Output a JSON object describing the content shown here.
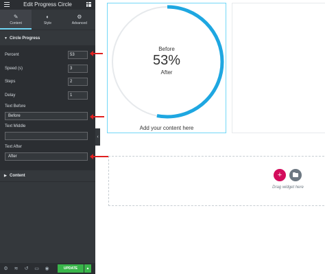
{
  "panel": {
    "title": "Edit Progress Circle",
    "tabs": [
      {
        "label": "Content",
        "icon": "pencil-icon",
        "active": true
      },
      {
        "label": "Style",
        "icon": "half-circle-icon",
        "active": false
      },
      {
        "label": "Advanced",
        "icon": "gear-icon",
        "active": false
      }
    ],
    "section_title": "Circle Progress",
    "fields": {
      "percent": {
        "label": "Percent",
        "value": "53"
      },
      "speed": {
        "label": "Speed (s)",
        "value": "3"
      },
      "steps": {
        "label": "Steps",
        "value": "2"
      },
      "delay": {
        "label": "Delay",
        "value": "1"
      },
      "text_before": {
        "label": "Text Before",
        "value": "Before"
      },
      "text_middle": {
        "label": "Text Middle",
        "value": ""
      },
      "text_after": {
        "label": "Text After",
        "value": "After"
      }
    },
    "content_section": "Content",
    "footer": {
      "update_label": "UPDATE",
      "icons": [
        "gear-icon",
        "layers-icon",
        "history-icon",
        "desktop-icon",
        "eye-icon"
      ]
    }
  },
  "canvas": {
    "circle": {
      "before": "Before",
      "percent_text": "53%",
      "after": "After",
      "progress": 0.53,
      "track_color": "#e6e9ec",
      "bar_color": "#1ea7e1"
    },
    "add_content": "Add your content here",
    "drag_text": "Drag widget here"
  },
  "colors": {
    "panel_bg": "#34383c",
    "accent": "#71d7f7",
    "update_green": "#39b54a",
    "add_pink": "#d30c5c",
    "arrow_red": "#e02020"
  }
}
